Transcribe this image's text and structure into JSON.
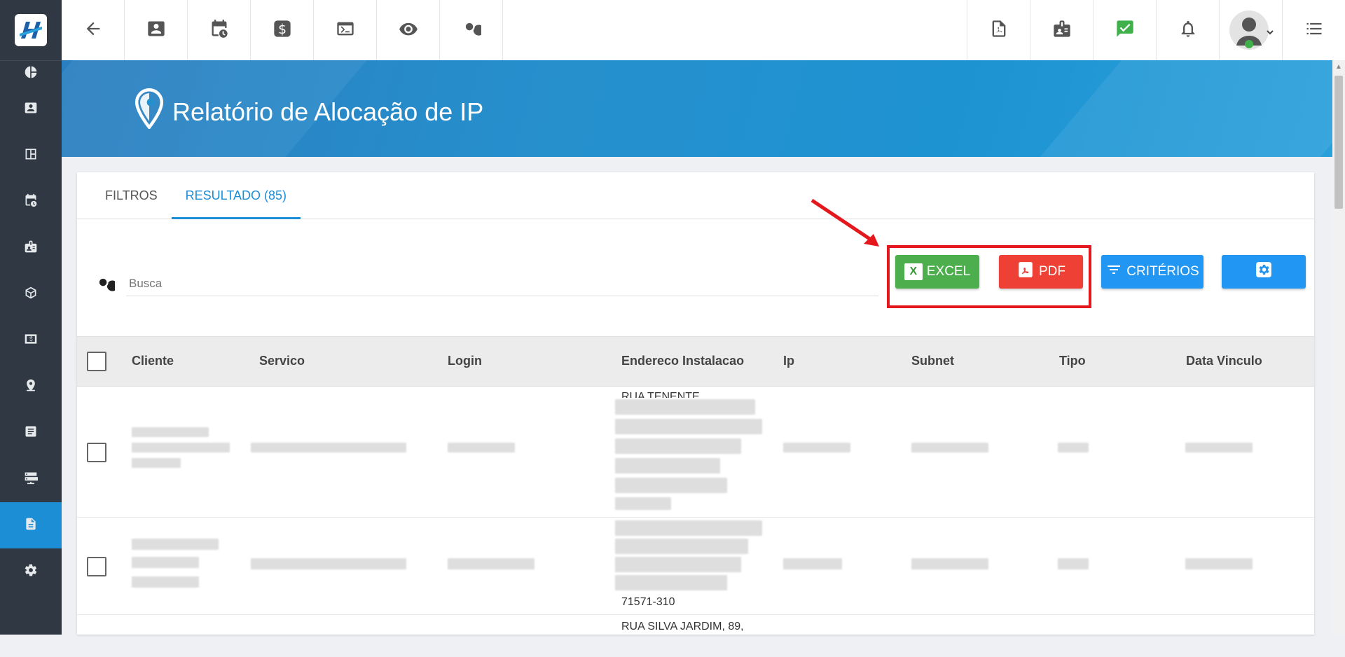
{
  "page": {
    "title": "Relatório de Alocação de IP"
  },
  "tabs": [
    {
      "label": "FILTROS"
    },
    {
      "label": "RESULTADO (85)"
    }
  ],
  "search": {
    "placeholder": "Busca"
  },
  "buttons": {
    "excel": "EXCEL",
    "pdf": "PDF",
    "criteria": "CRITÉRIOS"
  },
  "table": {
    "columns": [
      "Cliente",
      "Servico",
      "Login",
      "Endereco Instalacao",
      "Ip",
      "Subnet",
      "Tipo",
      "Data Vinculo"
    ],
    "rows": [
      {
        "endereco_fragment": "RUA TENENTE"
      },
      {
        "endereco_fragment": "71571-310"
      },
      {
        "endereco_fragment": "RUA SILVA JARDIM, 89,"
      }
    ]
  },
  "colors": {
    "sidebar": "#2f3843",
    "accent": "#1b8ed6",
    "excel": "#4cae4c",
    "pdf": "#ee4035",
    "criteria": "#2196f3",
    "highlight": "#e3171c"
  }
}
